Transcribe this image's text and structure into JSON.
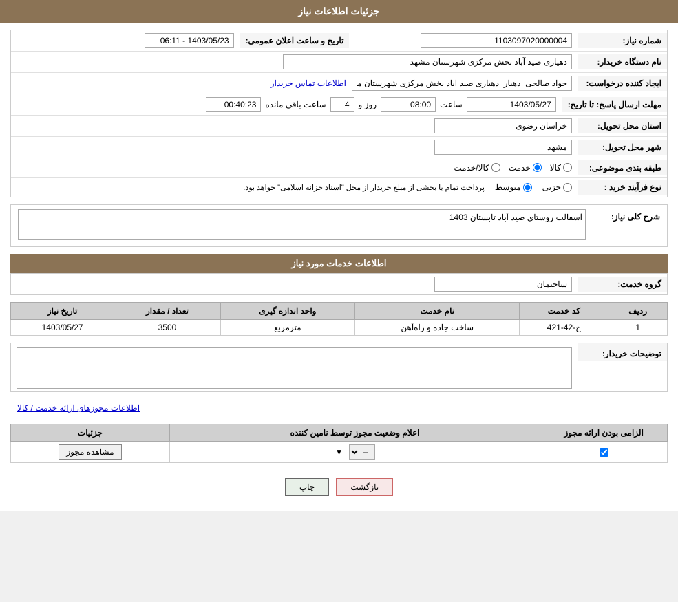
{
  "page": {
    "title": "جزئیات اطلاعات نیاز"
  },
  "header": {
    "announcement_date_label": "تاریخ و ساعت اعلان عمومی:",
    "announcement_date_value": "1403/05/23 - 06:11",
    "need_number_label": "شماره نیاز:",
    "need_number_value": "1103097020000004",
    "buyer_org_label": "نام دستگاه خریدار:",
    "buyer_org_value": "دهیاری صید آباد بخش مرکزی شهرستان مشهد",
    "requester_label": "ایجاد کننده درخواست:",
    "requester_value": "جواد صالحی  دهیار  دهیاری صید اباد بخش مرکزی شهرستان مشهد",
    "requester_link": "اطلاعات تماس خریدار",
    "deadline_label": "مهلت ارسال پاسخ: تا تاریخ:",
    "deadline_date": "1403/05/27",
    "deadline_time_label": "ساعت",
    "deadline_time": "08:00",
    "deadline_day_label": "روز و",
    "deadline_days": "4",
    "deadline_remaining_label": "ساعت باقی مانده",
    "deadline_remaining": "00:40:23",
    "province_label": "استان محل تحویل:",
    "province_value": "خراسان رضوی",
    "city_label": "شهر محل تحویل:",
    "city_value": "مشهد",
    "category_label": "طبقه بندی موضوعی:",
    "category_options": [
      {
        "label": "کالا",
        "value": "kala"
      },
      {
        "label": "خدمت",
        "value": "khedmat"
      },
      {
        "label": "کالا/خدمت",
        "value": "kala_khedmat"
      }
    ],
    "category_selected": "khedmat",
    "process_label": "نوع فرآیند خرید :",
    "process_options": [
      {
        "label": "جزیی",
        "value": "jozii"
      },
      {
        "label": "متوسط",
        "value": "motavasset"
      }
    ],
    "process_selected": "motavasset",
    "process_desc": "پرداخت تمام یا بخشی از مبلغ خریدار از محل \"اسناد خزانه اسلامی\" خواهد بود."
  },
  "need_description": {
    "section_title": "شرح کلی نیاز:",
    "value": "آسفالت روستای صید آباد تابستان 1403"
  },
  "services_section": {
    "title": "اطلاعات خدمات مورد نیاز",
    "service_group_label": "گروه خدمت:",
    "service_group_value": "ساختمان",
    "table": {
      "columns": [
        "ردیف",
        "کد خدمت",
        "نام خدمت",
        "واحد اندازه گیری",
        "تعداد / مقدار",
        "تاریخ نیاز"
      ],
      "rows": [
        {
          "row_num": "1",
          "code": "ج-42-421",
          "name": "ساخت جاده و راه‌آهن",
          "unit": "مترمربع",
          "quantity": "3500",
          "date": "1403/05/27"
        }
      ]
    }
  },
  "buyer_notes": {
    "label": "توضیحات خریدار:",
    "value": ""
  },
  "permits_section": {
    "footer_link": "اطلاعات مجوزهای ارائه خدمت / کالا",
    "table": {
      "columns": [
        "الزامی بودن ارائه مجوز",
        "اعلام وضعیت مجوز توسط نامین کننده",
        "جزئیات"
      ],
      "rows": [
        {
          "required": true,
          "status_value": "--",
          "details_label": "مشاهده مجوز"
        }
      ]
    }
  },
  "buttons": {
    "print": "چاپ",
    "back": "بازگشت"
  }
}
